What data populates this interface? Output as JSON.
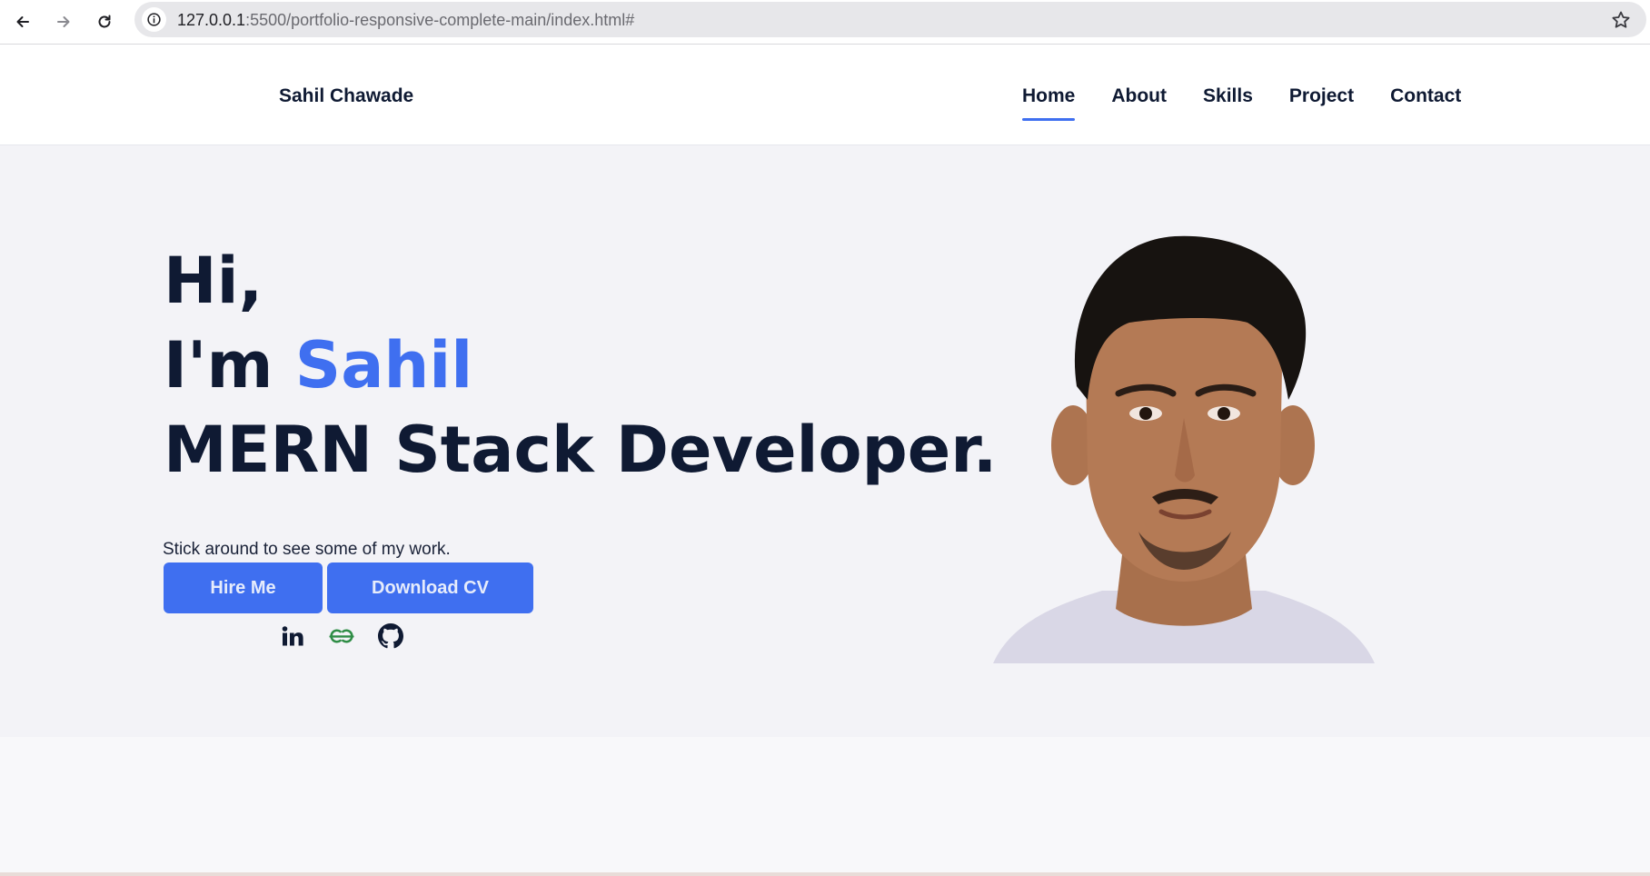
{
  "browser": {
    "url_host": "127.0.0.1",
    "url_rest": ":5500/portfolio-responsive-complete-main/index.html#",
    "icons": {
      "back": "arrow-left-icon",
      "forward": "arrow-right-icon",
      "reload": "reload-icon",
      "site_info": "info-icon",
      "bookmark": "star-icon"
    }
  },
  "header": {
    "brand": "Sahil Chawade",
    "menu": [
      {
        "label": "Home",
        "active": true
      },
      {
        "label": "About",
        "active": false
      },
      {
        "label": "Skills",
        "active": false
      },
      {
        "label": "Project",
        "active": false
      },
      {
        "label": "Contact",
        "active": false
      }
    ]
  },
  "hero": {
    "line1": "Hi,",
    "line2_prefix": "I'm ",
    "name": "Sahil",
    "line3": "MERN Stack Developer.",
    "tagline": "Stick around to see some of my work.",
    "hire_label": "Hire Me",
    "cv_label": "Download CV",
    "socials": [
      {
        "name": "linkedin-icon"
      },
      {
        "name": "geeksforgeeks-icon"
      },
      {
        "name": "github-icon"
      }
    ]
  },
  "colors": {
    "accent": "#3f6ff0",
    "text_dark": "#0f1a33",
    "hero_bg": "#f3f3f7",
    "gfg_green": "#2f8d46"
  }
}
